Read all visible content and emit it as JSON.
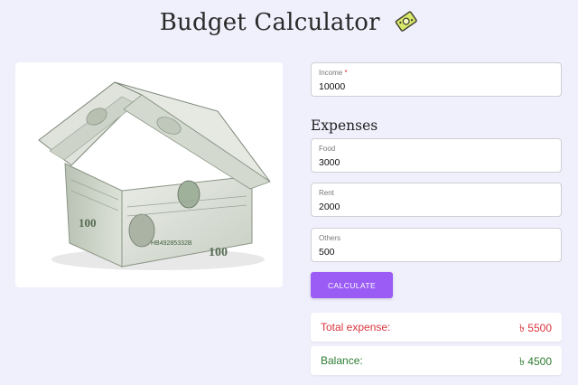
{
  "header": {
    "title": "Budget Calculator",
    "icon": "money-icon"
  },
  "image": {
    "description_icon": "money-house-icon"
  },
  "income": {
    "label": "Income",
    "required_mark": "*",
    "value": "10000"
  },
  "expenses": {
    "title": "Expenses",
    "food": {
      "label": "Food",
      "value": "3000"
    },
    "rent": {
      "label": "Rent",
      "value": "2000"
    },
    "others": {
      "label": "Others",
      "value": "500"
    }
  },
  "button": {
    "label": "CALCULATE",
    "color": "#9a5cf5"
  },
  "results": {
    "total_label": "Total expense:",
    "total_value": "৳ 5500",
    "balance_label": "Balance:",
    "balance_value": "৳ 4500",
    "expense_color": "#d9363e",
    "balance_color": "#2e7d32"
  }
}
